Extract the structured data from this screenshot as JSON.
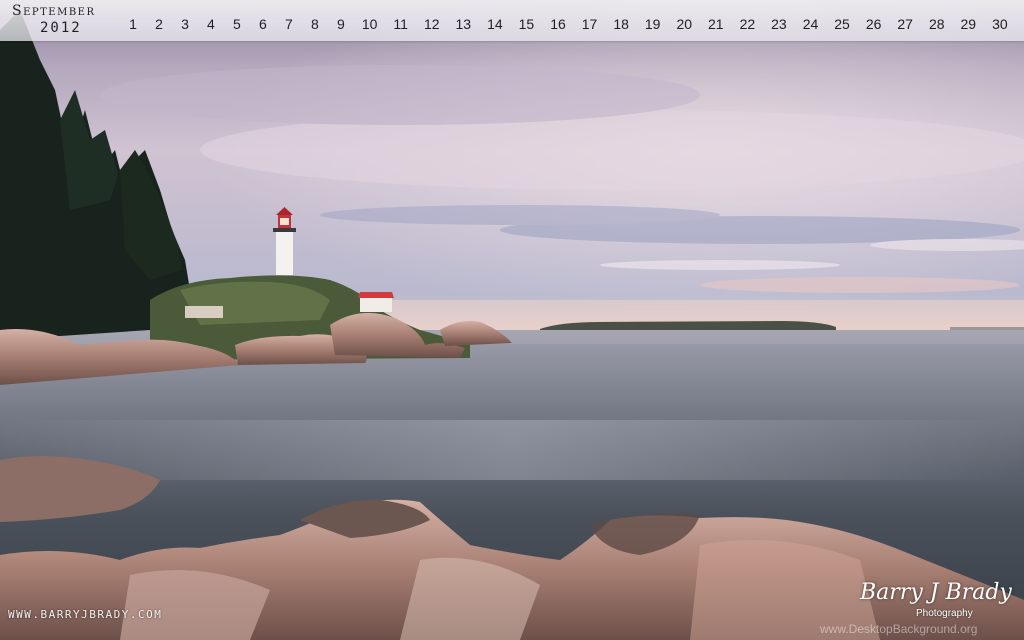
{
  "calendar": {
    "month": "September",
    "year": "2012",
    "days": [
      "1",
      "2",
      "3",
      "4",
      "5",
      "6",
      "7",
      "8",
      "9",
      "10",
      "11",
      "12",
      "13",
      "14",
      "15",
      "16",
      "17",
      "18",
      "19",
      "20",
      "21",
      "22",
      "23",
      "24",
      "25",
      "26",
      "27",
      "28",
      "29",
      "30"
    ]
  },
  "footer": {
    "website": "WWW.BARRYJBRADY.COM",
    "signature_name": "Barry J Brady",
    "signature_sub": "Photography",
    "watermark": "www.DesktopBackground.org"
  },
  "colors": {
    "sky_top": "#8a7fa0",
    "sky_mid": "#c9b9cf",
    "horizon": "#e9cfcb",
    "water": "#3f4750",
    "rock": "#b88f84",
    "tree": "#1c2a22",
    "lighthouse_red": "#c2323a"
  }
}
